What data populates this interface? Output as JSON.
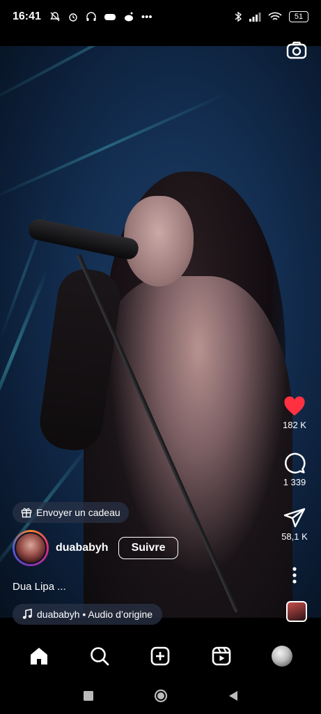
{
  "status_bar": {
    "time": "16:41",
    "battery": "51",
    "icons_left": [
      "mute-icon",
      "alarm-icon",
      "headphones-icon",
      "game-icon",
      "reddit-icon",
      "more-dots-icon"
    ],
    "icons_right": [
      "bluetooth-icon",
      "signal-icon",
      "wifi-icon",
      "battery-icon"
    ]
  },
  "reel": {
    "gift_label": "Envoyer un cadeau",
    "username": "duababyh",
    "follow_label": "Suivre",
    "caption": "Dua Lipa ...",
    "audio_label": "duababyh • Audio d’origine"
  },
  "actions": {
    "likes": "182 K",
    "comments": "1 339",
    "shares": "58,1 K"
  },
  "colors": {
    "like": "#ff3040",
    "background": "#000000",
    "pill": "#28324680"
  },
  "bottom_nav": [
    "home-icon",
    "search-icon",
    "create-icon",
    "reels-icon",
    "profile-avatar"
  ],
  "system_nav": [
    "recents-button",
    "home-button",
    "back-button"
  ]
}
